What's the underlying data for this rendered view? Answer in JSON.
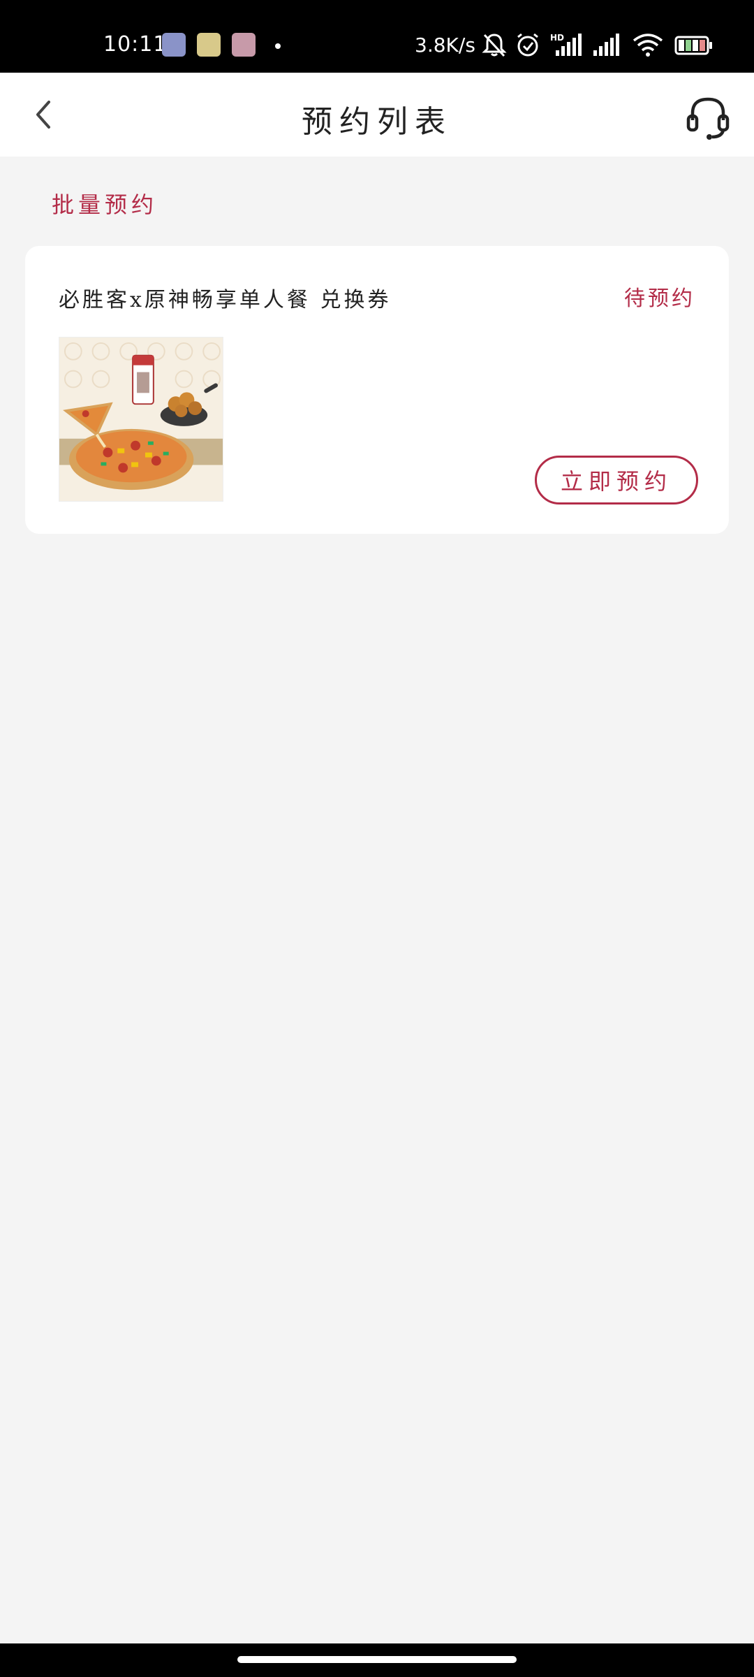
{
  "status_bar": {
    "time": "10:11",
    "net_speed": "3.8K/s",
    "notification_icons": [
      "app-notification-icon-1",
      "app-notification-icon-2",
      "app-notification-icon-3"
    ],
    "system_icons": [
      "mute-bell-icon",
      "alarm-icon",
      "hd-signal-icon",
      "signal-icon",
      "wifi-icon",
      "battery-icon"
    ]
  },
  "header": {
    "title": "预约列表",
    "back_icon": "chevron-left-icon",
    "support_icon": "headset-icon"
  },
  "batch_link": "批量预约",
  "card": {
    "title": "必胜客x原神畅享单人餐 兑换券",
    "status": "待预约",
    "image_icon": "pizza-meal-image",
    "button_label": "立即预约"
  },
  "colors": {
    "accent": "#b32c48",
    "background": "#f4f4f4",
    "card": "#ffffff",
    "status_bar": "#000000"
  }
}
